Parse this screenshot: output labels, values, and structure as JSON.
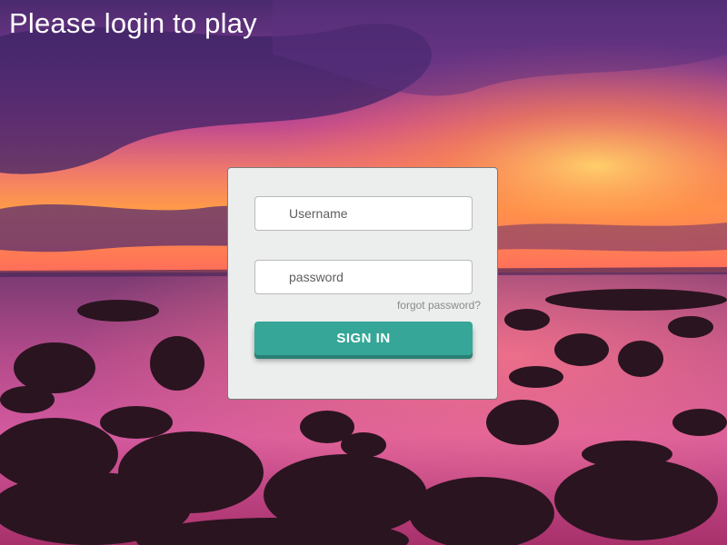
{
  "page": {
    "title": "Please login to play"
  },
  "login": {
    "username_placeholder": "Username",
    "username_value": "",
    "password_placeholder": "password",
    "password_value": "",
    "forgot_label": "forgot password?",
    "signin_label": "SIGN IN"
  },
  "colors": {
    "accent": "#35a697",
    "panel": "#eceeed"
  }
}
